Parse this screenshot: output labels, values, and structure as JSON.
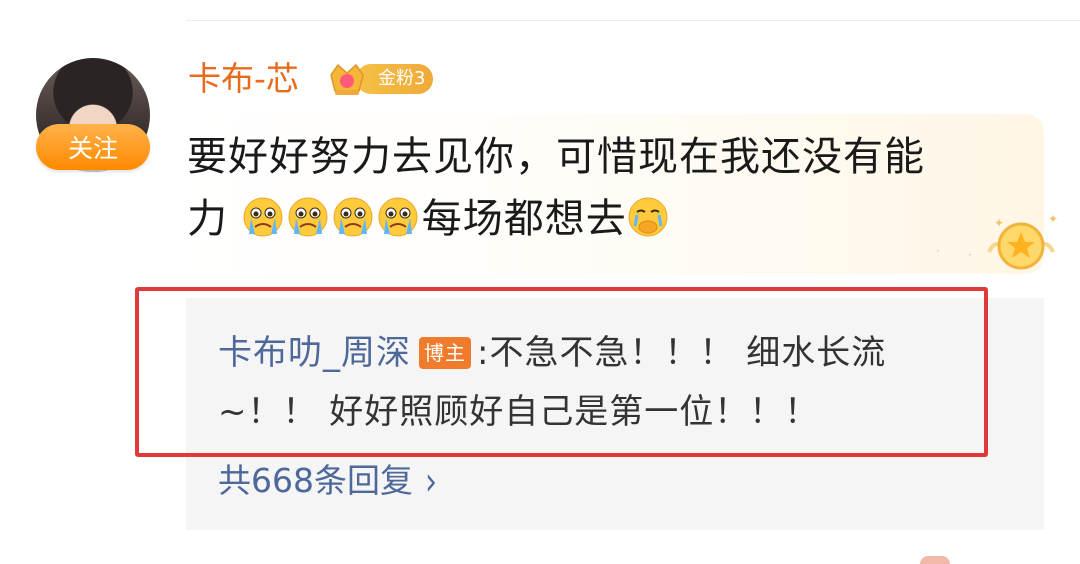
{
  "comment": {
    "username": "卡布-芯",
    "fan_badge": "金粉3",
    "follow_label": "关注",
    "text_line1": "要好好努力去见你，可惜现在我还没有能",
    "text_line2_start": "力",
    "text_line2_mid": "每场都想去",
    "emoji_names": [
      "crying-face-icon",
      "crying-face-icon",
      "crying-face-icon",
      "crying-face-icon",
      "crying-cover-mouth-icon"
    ]
  },
  "reply": {
    "author": "卡布叻_周深",
    "author_tag": "博主",
    "text_line1": ":不急不急！！！ 细水长流",
    "text_line2": "~！！ 好好照顾好自己是第一位！！！",
    "reply_count_label": "共668条回复",
    "chevron": "›"
  },
  "colors": {
    "username": "#e86b1c",
    "reply_author": "#4d6899",
    "highlight_frame": "#e0393a",
    "follow_button": "#ff8a00"
  }
}
